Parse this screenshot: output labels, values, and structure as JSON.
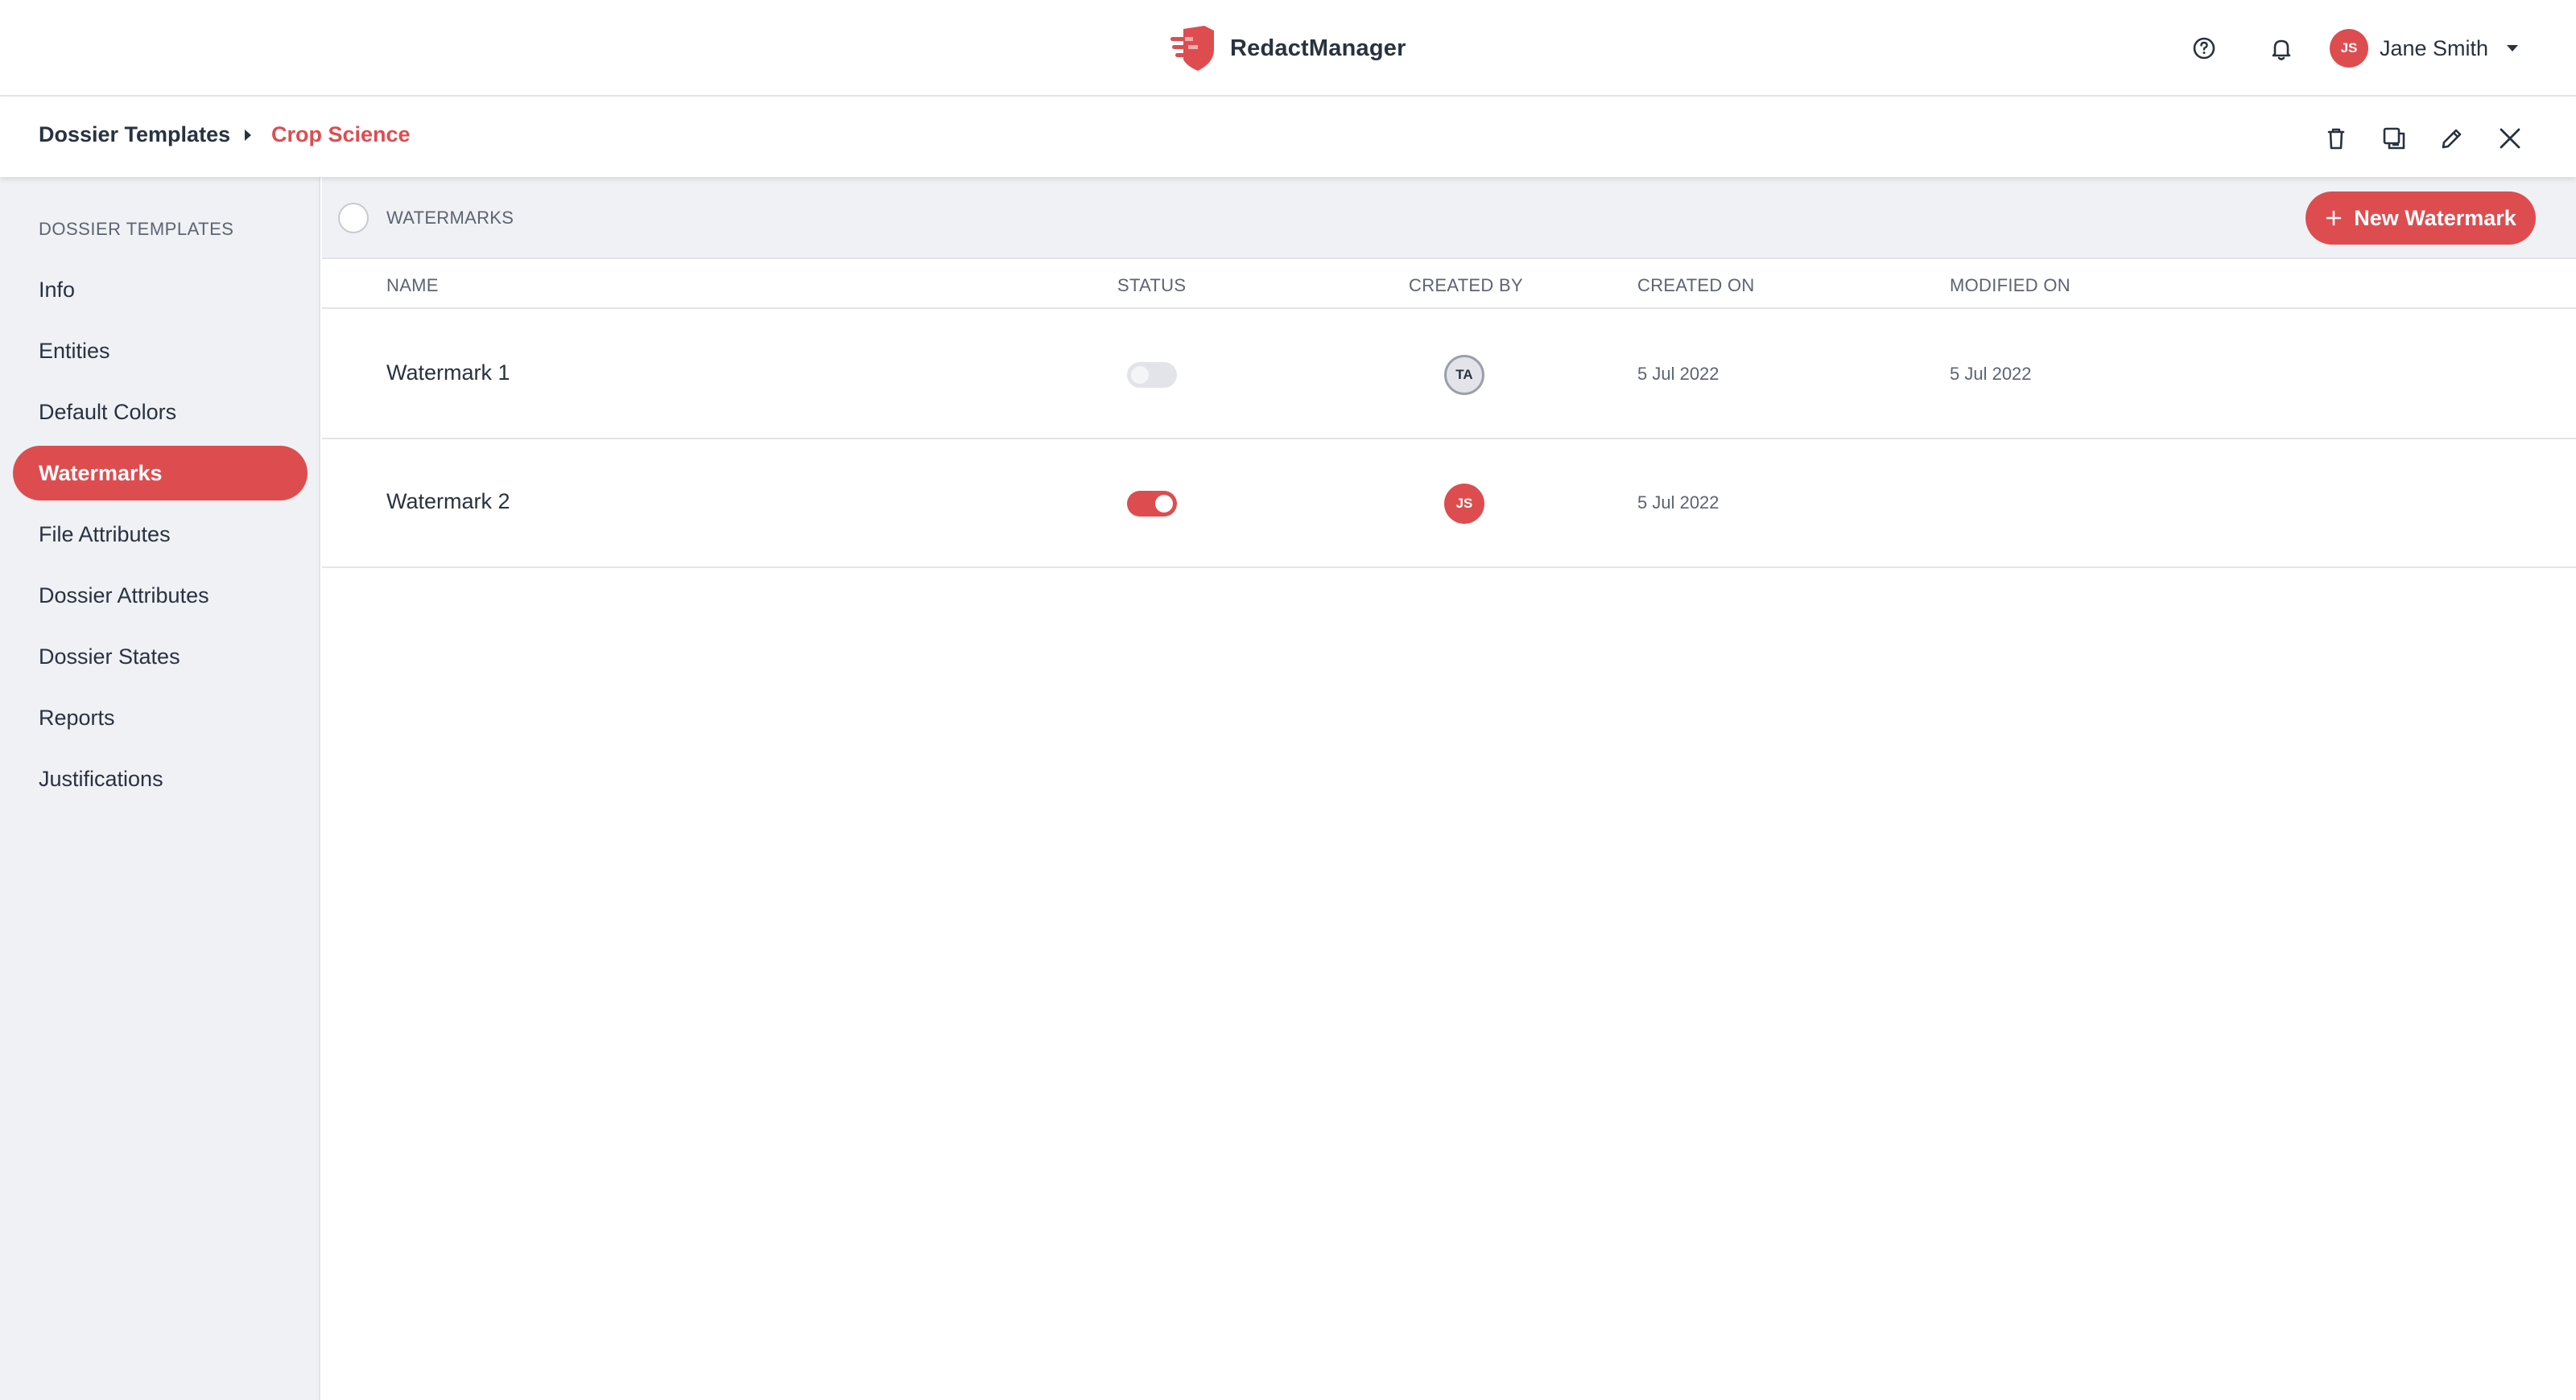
{
  "app": {
    "name": "RedactManager",
    "brand_color": "#dd4d50"
  },
  "header": {
    "user": {
      "initials": "JS",
      "name": "Jane Smith"
    },
    "icons": [
      "help-icon",
      "bell-icon",
      "chevron-down-icon"
    ]
  },
  "breadcrumb": {
    "root": "Dossier Templates",
    "current": "Crop Science",
    "actions": [
      "trash-icon",
      "copy-icon",
      "pencil-icon",
      "close-icon"
    ]
  },
  "sidebar": {
    "heading": "DOSSIER TEMPLATES",
    "items": [
      {
        "label": "Info",
        "active": false
      },
      {
        "label": "Entities",
        "active": false
      },
      {
        "label": "Default Colors",
        "active": false
      },
      {
        "label": "Watermarks",
        "active": true
      },
      {
        "label": "File Attributes",
        "active": false
      },
      {
        "label": "Dossier Attributes",
        "active": false
      },
      {
        "label": "Dossier States",
        "active": false
      },
      {
        "label": "Reports",
        "active": false
      },
      {
        "label": "Justifications",
        "active": false
      }
    ]
  },
  "list": {
    "title": "WATERMARKS",
    "new_button_label": "New Watermark",
    "columns": {
      "name": "NAME",
      "status": "STATUS",
      "created_by": "CREATED BY",
      "created_on": "CREATED ON",
      "modified_on": "MODIFIED ON"
    },
    "rows": [
      {
        "name": "Watermark 1",
        "enabled": false,
        "created_by": "TA",
        "created_on": "5 Jul 2022",
        "modified_on": "5 Jul 2022"
      },
      {
        "name": "Watermark 2",
        "enabled": true,
        "created_by": "JS",
        "created_on": "5 Jul 2022",
        "modified_on": ""
      }
    ]
  }
}
